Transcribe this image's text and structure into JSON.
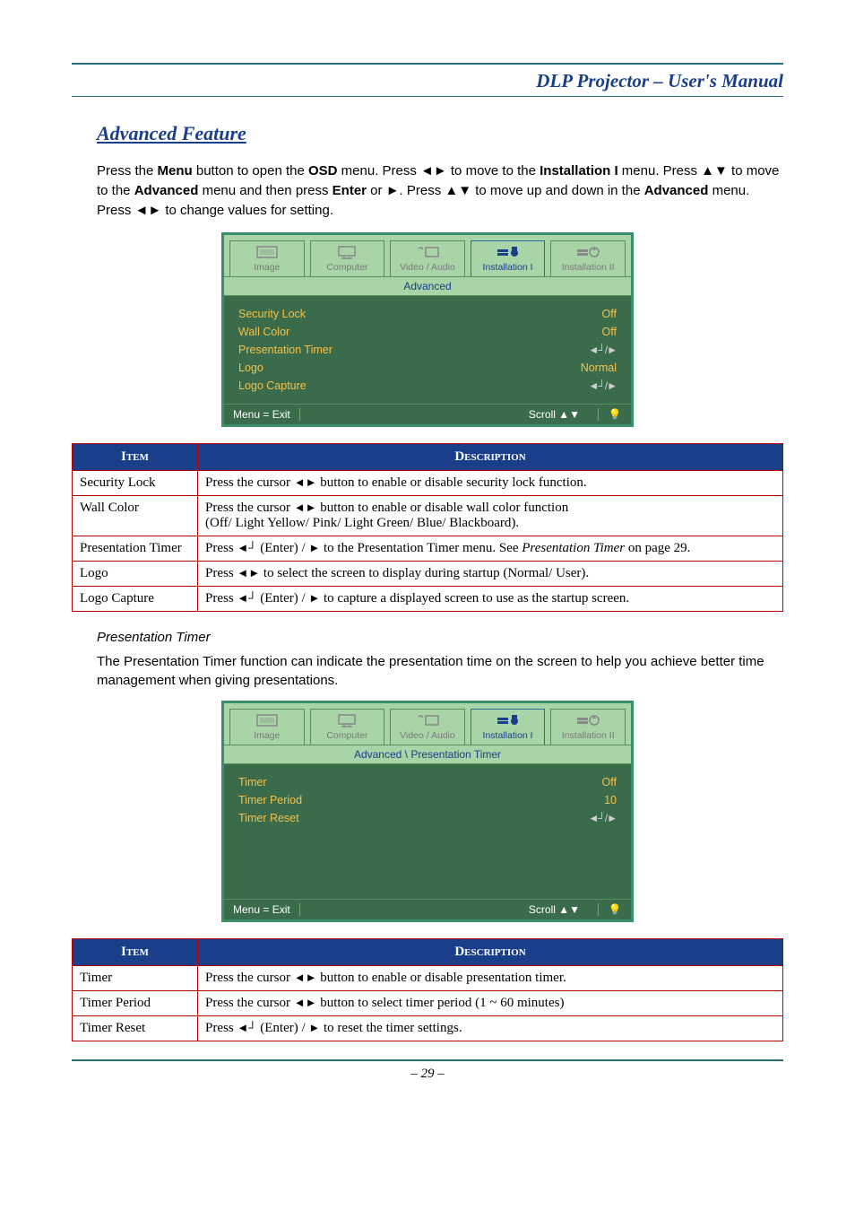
{
  "header": {
    "title": "DLP Projector – User's Manual"
  },
  "section": {
    "title": "Advanced Feature"
  },
  "instructions": {
    "pre1": "Press the ",
    "b1": "Menu",
    "t1": " button to open the ",
    "b2": "OSD",
    "t2": " menu. Press ◄► to move to the ",
    "b3": "Installation I",
    "t3": " menu. Press ▲▼ to move to the ",
    "b4": "Advanced",
    "t4": " menu and then press ",
    "b5": "Enter",
    "t5": " or ►. Press ▲▼ to move up and down in the ",
    "b6": "Advanced",
    "t6": " menu. Press ◄► to change values for setting."
  },
  "osd1": {
    "tabs": [
      "Image",
      "Computer",
      "Video / Audio",
      "Installation I",
      "Installation II"
    ],
    "activeTab": 3,
    "breadcrumb": "Advanced",
    "rows": [
      {
        "label": "Security Lock",
        "value": "Off",
        "type": "text"
      },
      {
        "label": "Wall Color",
        "value": "Off",
        "type": "text"
      },
      {
        "label": "Presentation Timer",
        "value": "↵/►",
        "type": "enter"
      },
      {
        "label": "Logo",
        "value": "Normal",
        "type": "text"
      },
      {
        "label": "Logo Capture",
        "value": "↵/►",
        "type": "enter"
      }
    ],
    "footer": {
      "menuExit": "Menu = Exit",
      "scroll": "Scroll ▲▼"
    }
  },
  "table1": {
    "headers": [
      "Item",
      "Description"
    ],
    "rows": [
      {
        "item": "Security Lock",
        "desc_pre": "Press the cursor ",
        "desc_post": " button to enable or disable security lock function.",
        "icons": "lr"
      },
      {
        "item": "Wall Color",
        "desc_pre": "Press the cursor ",
        "desc_post": " button to enable or disable wall color function",
        "icons": "lr",
        "line2": "(Off/ Light Yellow/ Pink/ Light Green/ Blue/ Blackboard)."
      },
      {
        "item": "Presentation Timer",
        "desc_pre": "Press ",
        "desc_mid": " (Enter) / ",
        "desc_post": " to the Presentation Timer menu. See ",
        "ital": "Presentation Timer",
        "desc_end": " on page 29.",
        "icons": "enter-r"
      },
      {
        "item": "Logo",
        "desc_pre": "Press ",
        "desc_post": " to select the screen to display during startup (Normal/ User).",
        "icons": "lr"
      },
      {
        "item": "Logo Capture",
        "desc_pre": "Press ",
        "desc_mid": " (Enter) / ",
        "desc_post": " to capture a displayed screen to use as the startup screen.",
        "icons": "enter-r"
      }
    ]
  },
  "sub": {
    "title": "Presentation Timer",
    "text": "The Presentation Timer function can indicate the presentation time on the screen to help you achieve better time management when giving presentations."
  },
  "osd2": {
    "tabs": [
      "Image",
      "Computer",
      "Video / Audio",
      "Installation I",
      "Installation II"
    ],
    "activeTab": 3,
    "breadcrumb": "Advanced \\ Presentation Timer",
    "rows": [
      {
        "label": "Timer",
        "value": "Off",
        "type": "text"
      },
      {
        "label": "Timer Period",
        "value": "10",
        "type": "text"
      },
      {
        "label": "Timer Reset",
        "value": "↵/►",
        "type": "enter"
      }
    ],
    "footer": {
      "menuExit": "Menu = Exit",
      "scroll": "Scroll ▲▼"
    }
  },
  "table2": {
    "headers": [
      "Item",
      "Description"
    ],
    "rows": [
      {
        "item": "Timer",
        "desc_pre": "Press the cursor ",
        "desc_post": " button to enable or disable presentation timer.",
        "icons": "lr"
      },
      {
        "item": "Timer Period",
        "desc_pre": "Press the cursor ",
        "desc_post": " button to select timer period (1 ~ 60 minutes)",
        "icons": "lr"
      },
      {
        "item": "Timer Reset",
        "desc_pre": "Press ",
        "desc_mid": " (Enter) / ",
        "desc_post": " to reset the timer settings.",
        "icons": "enter-r"
      }
    ]
  },
  "pageNumber": "– 29 –"
}
